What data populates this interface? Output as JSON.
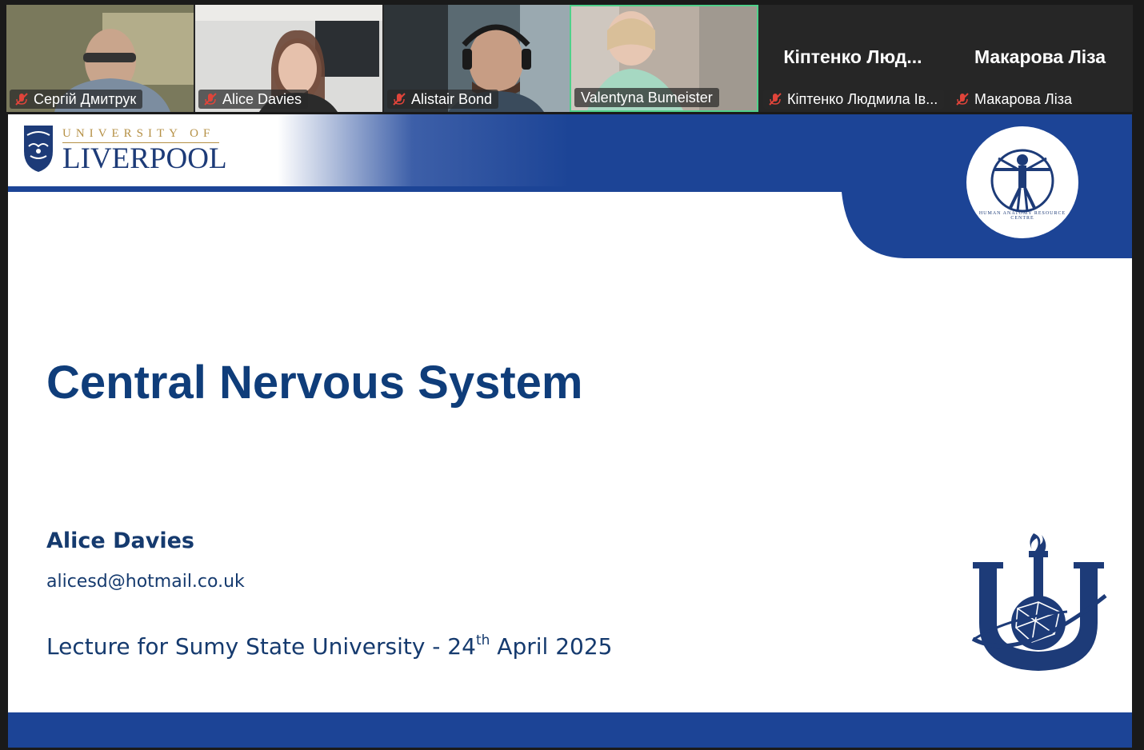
{
  "participants": [
    {
      "name": "Сергій Дмитрук",
      "muted": true,
      "video": true,
      "active": false
    },
    {
      "name": "Alice Davies",
      "muted": true,
      "video": true,
      "active": false
    },
    {
      "name": "Alistair Bond",
      "muted": true,
      "video": true,
      "active": false
    },
    {
      "name": "Valentyna Bumeister",
      "muted": false,
      "video": true,
      "active": true
    },
    {
      "name": "Кіптенко Людмила Ів...",
      "display_name": "Кіптенко Люд...",
      "muted": true,
      "video": false,
      "active": false
    },
    {
      "name": "Макарова Ліза",
      "display_name": "Макарова Ліза",
      "muted": true,
      "video": false,
      "active": false
    }
  ],
  "slide": {
    "university_top": "UNIVERSITY OF",
    "university_main": "LIVERPOOL",
    "anatomy_caption": "HUMAN ANATOMY RESOURCE CENTRE",
    "title": "Central Nervous System",
    "author": "Alice Davies",
    "email": "alicesd@hotmail.co.uk",
    "lecture_prefix": "Lecture for Sumy State University - 24",
    "lecture_sup": "th",
    "lecture_suffix": " April 2025"
  },
  "colors": {
    "slide_blue": "#1c4496",
    "title_blue": "#0f3d7a",
    "active_speaker": "#4fd08a",
    "muted_icon": "#e0443a"
  }
}
